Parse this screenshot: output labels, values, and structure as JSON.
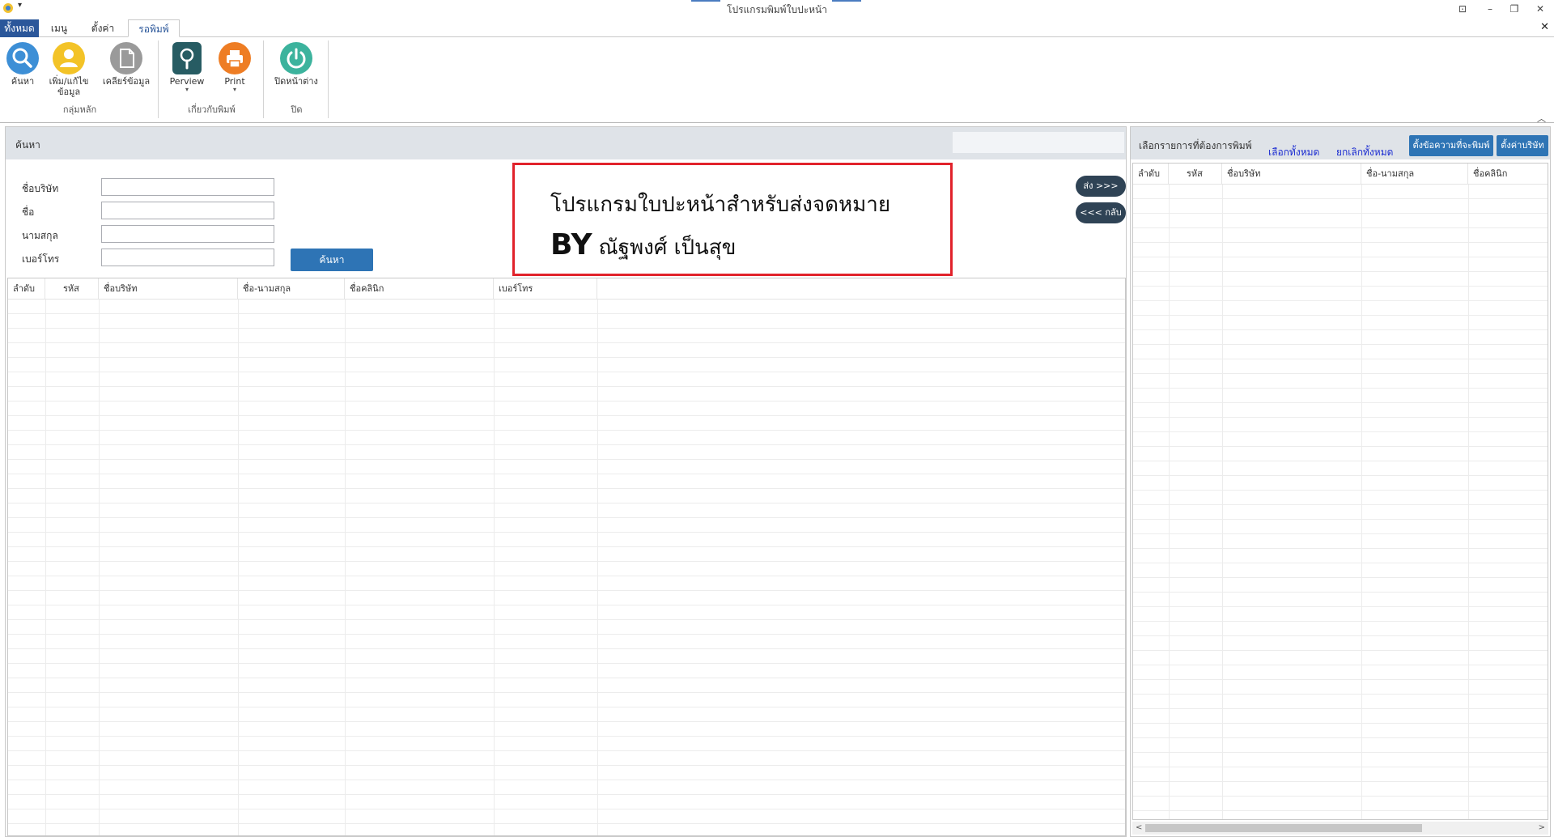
{
  "window": {
    "title": "โปรแกรมพิมพ์ใบปะหน้า",
    "qat_arrow": "▾",
    "controls": [
      "⊡",
      "–",
      "❐",
      "✕"
    ]
  },
  "ribbon": {
    "tabs": [
      {
        "label": "ทั้งหมด"
      },
      {
        "label": "เมนู"
      },
      {
        "label": "ตั้งค่า"
      },
      {
        "label": "รอพิมพ์"
      }
    ],
    "close_label": "✕",
    "collapse_label": "︿",
    "groups": {
      "main": {
        "label": "กลุ่มหลัก",
        "search": "ค้นหา",
        "add_edit_line1": "เพิ่ม/แก้ไข",
        "add_edit_line2": "ข้อมูล",
        "clear": "เคลียร์ข้อมูล"
      },
      "print": {
        "label": "เกี่ยวกับพิมพ์",
        "preview": "Perview",
        "print": "Print",
        "dropdown_glyph": "▾"
      },
      "close": {
        "label": "ปิด",
        "close_window": "ปิดหน้าต่าง"
      }
    },
    "icon_colors": {
      "search": "#3d8fd6",
      "add_edit": "#f3c327",
      "clear": "#9a9a9a",
      "preview": "#275c63",
      "print": "#ee7d24",
      "close": "#3cb39d"
    }
  },
  "left": {
    "header_title": "ค้นหา",
    "form": {
      "company_label": "ชื่อบริษัท",
      "name_label": "ชื่อ",
      "surname_label": "นามสกุล",
      "phone_label": "เบอร์โทร",
      "company_value": "",
      "name_value": "",
      "surname_value": "",
      "phone_value": "",
      "search_button": "ค้นหา"
    },
    "banner": {
      "line1": "โปรแกรมใบปะหน้าสำหรับส่งจดหมาย",
      "by": "BY",
      "author": "ณัฐพงศ์ เป็นสุข"
    },
    "send_button": "ส่ง >>>",
    "back_button": "<<< กลับ",
    "grid": {
      "columns": [
        "ลำดับ",
        "รหัส",
        "ชื่อบริษัท",
        "ชื่อ-นามสกุล",
        "ชื่อคลินิก",
        "เบอร์โทร"
      ],
      "rows": []
    }
  },
  "right": {
    "header_title": "เลือกรายการที่ต้องการพิมพ์",
    "select_all": "เลือกทั้งหมด",
    "deselect_all": "ยกเลิกทั้งหมด",
    "print_settings_button": "ตั้งข้อความที่จะพิมพ์",
    "company_settings_button": "ตั้งค่าบริษัท",
    "grid": {
      "columns": [
        "ลำดับ",
        "รหัส",
        "ชื่อบริษัท",
        "ชื่อ-นามสกุล",
        "ชื่อคลินิก"
      ],
      "rows": []
    },
    "scroll_left": "<",
    "scroll_right": ">"
  }
}
